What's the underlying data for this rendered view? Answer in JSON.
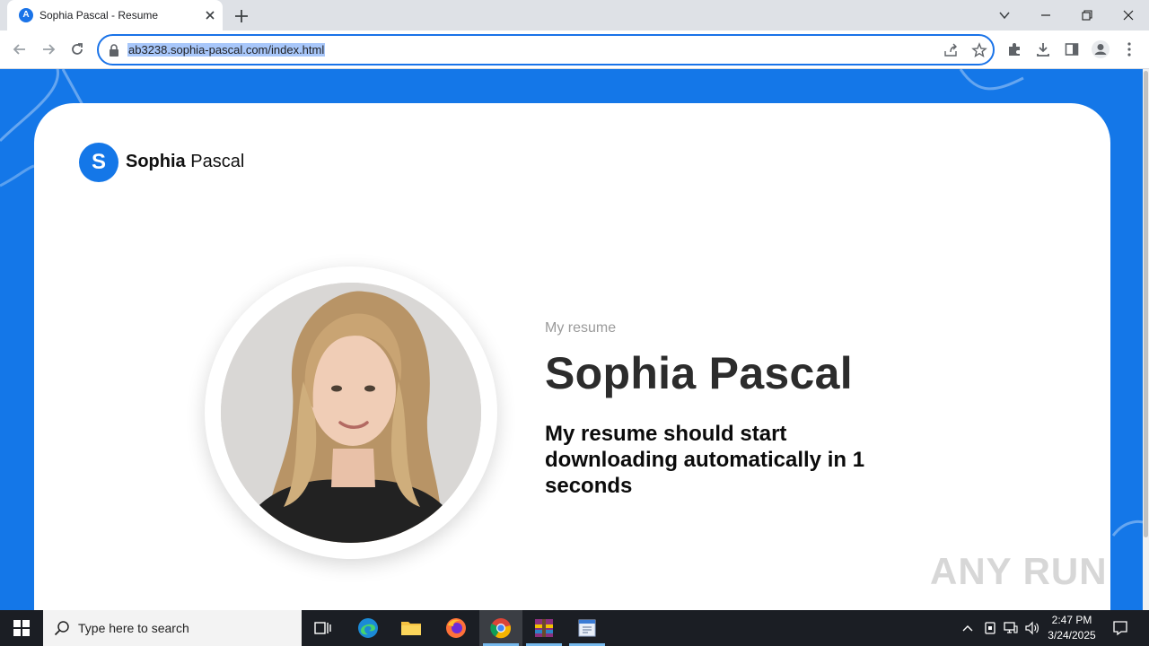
{
  "browser": {
    "tab": {
      "favicon_letter": "A",
      "title": "Sophia Pascal - Resume"
    },
    "address_bar": {
      "url": "ab3238.sophia-pascal.com/index.html"
    }
  },
  "page": {
    "logo": {
      "letter": "S",
      "first_name": "Sophia",
      "last_name": "Pascal"
    },
    "eyebrow": "My resume",
    "headline": "Sophia Pascal",
    "message": "My resume should start downloading automatically in 1 seconds",
    "watermark": "ANY RUN"
  },
  "taskbar": {
    "search_placeholder": "Type here to search",
    "clock": {
      "time": "2:47 PM",
      "date": "3/24/2025"
    }
  },
  "colors": {
    "page_background": "#1477e8",
    "accent": "#1a73e8",
    "taskbar": "#1b1e24"
  }
}
